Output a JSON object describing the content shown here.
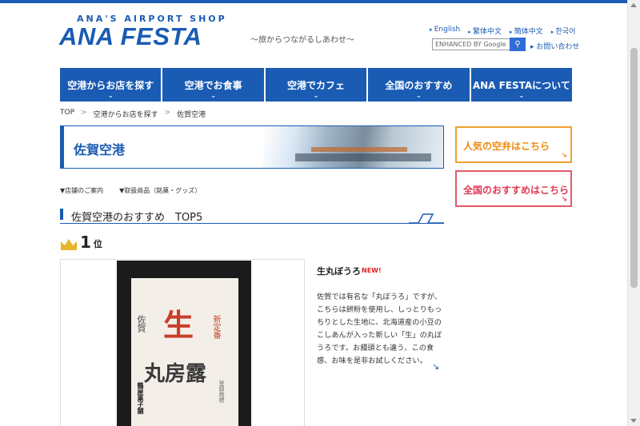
{
  "header": {
    "logo_sub": "ANA'S AIRPORT SHOP",
    "logo_main": "ANA FESTA",
    "tagline": "～旅からつながるしあわせ～",
    "lang_links": [
      "English",
      "繁体中文",
      "簡体中文",
      "한국어"
    ],
    "search_placeholder": "ENHANCED BY Google",
    "contact": "お問い合わせ"
  },
  "nav": {
    "items": [
      "空港からお店を探す",
      "空港でお食事",
      "空港でカフェ",
      "全国のおすすめ",
      "ANA FESTAについて"
    ]
  },
  "breadcrumb": [
    "TOP",
    "空港からお店を探す",
    "佐賀空港"
  ],
  "banner": {
    "title": "佐賀空港"
  },
  "side": {
    "btn1": "人気の空弁はこちら",
    "btn2": "全国のおすすめはこちら"
  },
  "anchors": [
    "▼店舗のご案内",
    "▼取扱商品（銘菓・グッズ）"
  ],
  "section": {
    "title": "佐賀空港のおすすめ　TOP5"
  },
  "rank": {
    "num": "1",
    "suffix": "位"
  },
  "product": {
    "name": "生丸ぼうろ",
    "badge": "NEW!",
    "description": "佐賀では有名な「丸ぼうろ」ですが、こちらは餅粉を使用し、しっとりもっちりとした生地に、北海道産の小豆のこしあんが入った新しい「生」の丸ぼうろです。お饅頭とも違う、この食感、お味を是非お試しください。",
    "pkg_left": "佐賀",
    "pkg_main": "生",
    "pkg_new": "新定番",
    "pkg_big": "丸房露",
    "pkg_small": "登録商標",
    "pkg_brand": "鶴屋菓子舗"
  },
  "colors": {
    "brand": "#1a5bb3",
    "orange": "#ef8a10",
    "pink": "#e03a55"
  }
}
